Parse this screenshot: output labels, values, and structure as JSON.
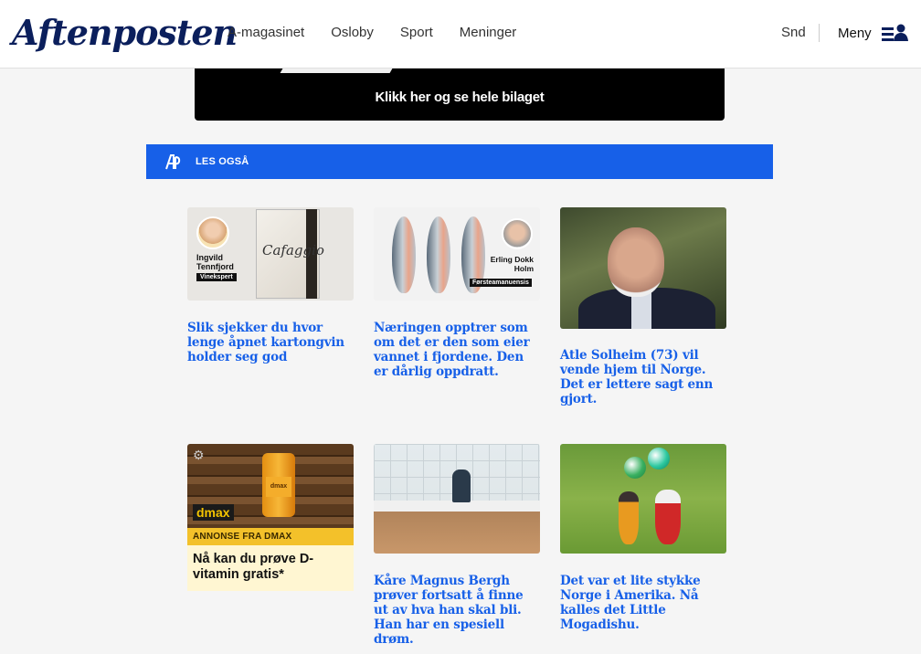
{
  "header": {
    "logo": "Aftenposten",
    "nav": [
      "A-magasinet",
      "Osloby",
      "Sport",
      "Meninger"
    ],
    "snd": "Snd",
    "menu_label": "Meny"
  },
  "banner": {
    "text": "Klikk her og se hele bilaget"
  },
  "les_ogsa": {
    "label": "LES OGSÅ"
  },
  "cards": [
    {
      "title": "Slik sjekker du hvor lenge åpnet kartongvin holder seg god",
      "image_text": {
        "name": "Ingvild Tennfjord",
        "tag": "Vinekspert",
        "product": "Cafaggio"
      }
    },
    {
      "title": "Næringen opptrer som om det er den som eier vannet i fjordene. Den er dårlig oppdratt.",
      "image_text": {
        "name": "Erling Dokk Holm",
        "tag": "Førsteamanuensis"
      }
    },
    {
      "title": "Atle Solheim (73) vil vende hjem til Norge. Det er lettere sagt enn gjort."
    },
    {
      "ad_label": "ANNONSE FRA DMAX",
      "ad_title": "Nå kan du prøve D-vitamin gratis*",
      "image_text": {
        "brand": "dmax",
        "bottle": "dmax"
      }
    },
    {
      "title": "Kåre Magnus Bergh prøver fortsatt å finne ut av hva han skal bli. Han har en spesiell drøm."
    },
    {
      "title": "Det var et lite stykke Norge i Amerika. Nå kalles det Little Mogadishu."
    }
  ],
  "colors": {
    "accent": "#1760e8",
    "logo": "#0b1f5c",
    "ad_yellow": "#f3c12a",
    "ad_body": "#fff6d2"
  },
  "icons": {
    "menu": "user-menu-icon",
    "les": "aftenposten-a-icon",
    "ad_settings": "gear-icon"
  }
}
